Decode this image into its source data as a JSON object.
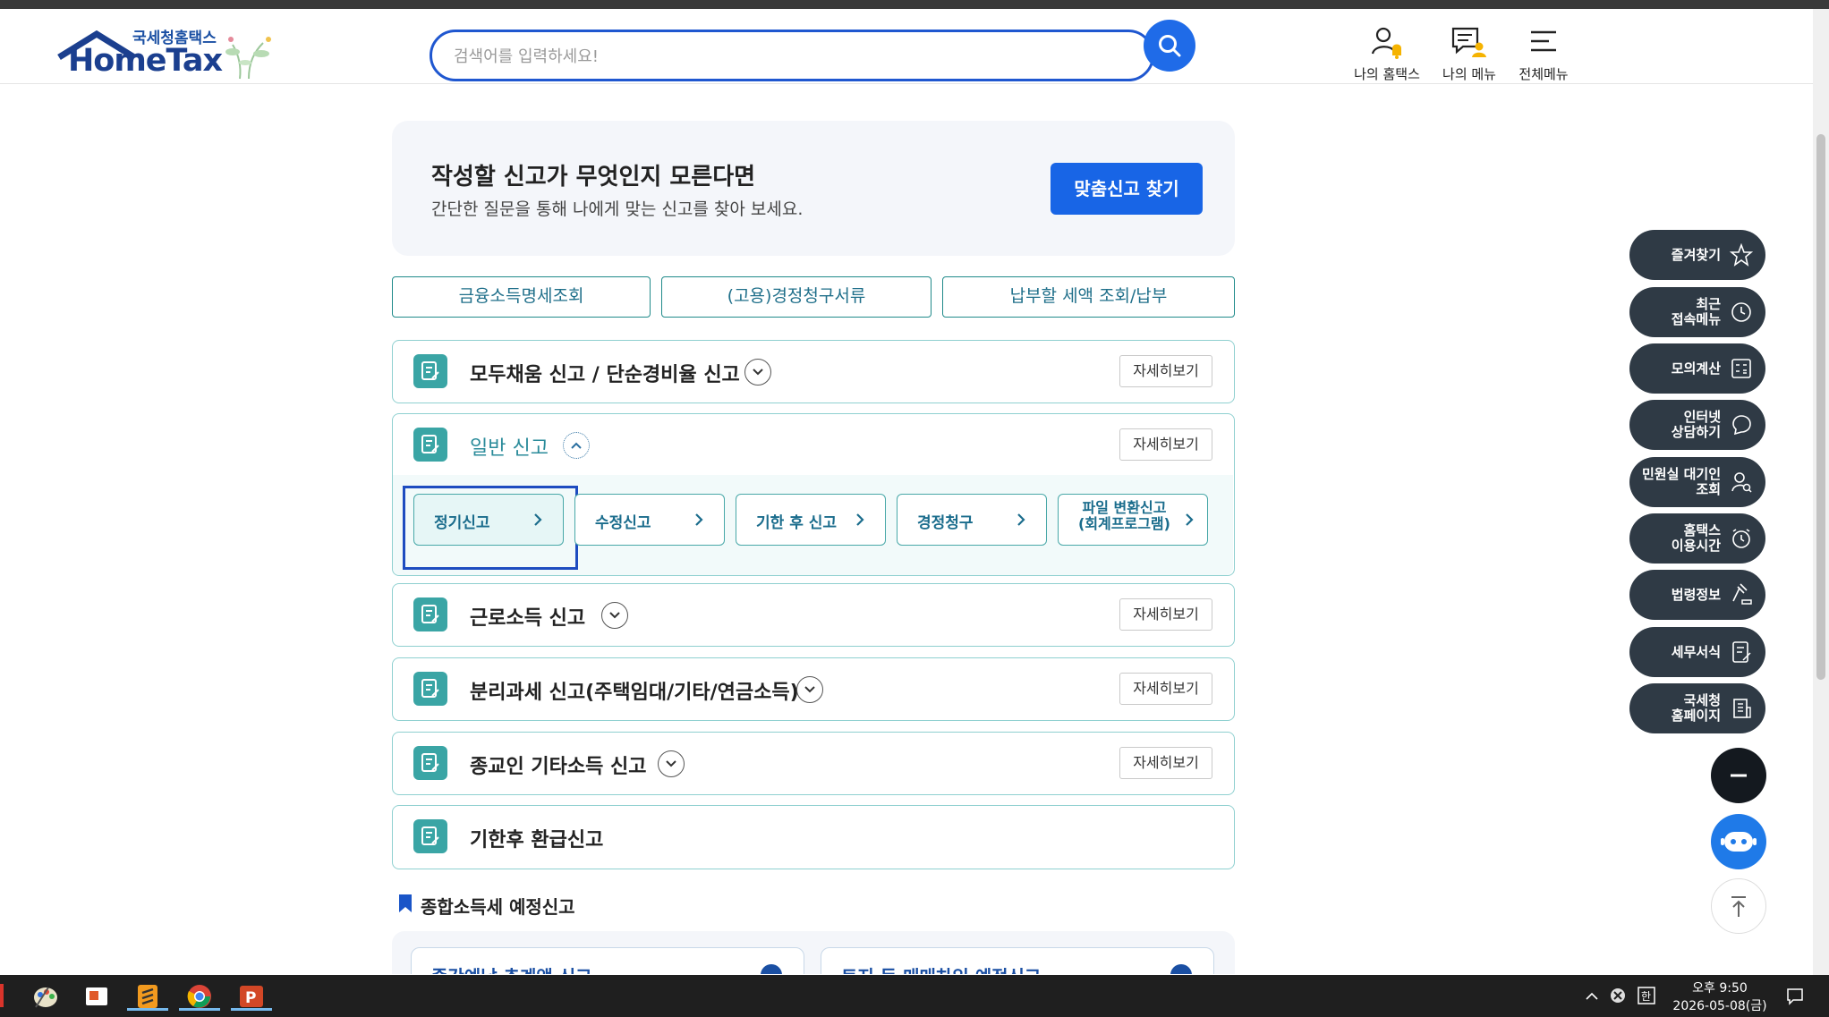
{
  "header": {
    "logo_small": "국세청홈택스",
    "logo_main": "HomeTax",
    "search_placeholder": "검색어를 입력하세요!",
    "nav": [
      "나의 홈택스",
      "나의 메뉴",
      "전체메뉴"
    ]
  },
  "banner": {
    "title": "작성할 신고가 무엇인지 모른다면",
    "subtitle": "간단한 질문을 통해 나에게 맞는 신고를 찾아 보세요.",
    "button": "맞춤신고 찾기"
  },
  "quick_buttons": [
    "금융소득명세조회",
    "(고용)경정청구서류",
    "납부할 세액 조회/납부"
  ],
  "cards": [
    {
      "title": "모두채움 신고 / 단순경비율 신고",
      "detail": "자세히보기"
    },
    {
      "title": "일반 신고",
      "detail": "자세히보기",
      "expanded": true
    },
    {
      "title": "근로소득 신고",
      "detail": "자세히보기"
    },
    {
      "title": "분리과세 신고(주택임대/기타/연금소득)",
      "detail": "자세히보기"
    },
    {
      "title": "종교인 기타소득 신고",
      "detail": "자세히보기"
    },
    {
      "title": "기한후 환급신고"
    }
  ],
  "sub_buttons": [
    "정기신고",
    "수정신고",
    "기한 후 신고",
    "경정청구",
    "파일 변환신고",
    "(회계프로그램)"
  ],
  "section": {
    "title": "종합소득세 예정신고",
    "cards": [
      "중간예납 추계액 신고",
      "토지 등 매매차익 예정신고"
    ]
  },
  "floating_menu": [
    {
      "label": "즐겨찾기",
      "icon": "star-icon"
    },
    {
      "label": "최근\n접속메뉴",
      "icon": "clock-icon"
    },
    {
      "label": "모의계산",
      "icon": "calculator-icon"
    },
    {
      "label": "인터넷\n상담하기",
      "icon": "chat-icon"
    },
    {
      "label": "민원실 대기인\n조회",
      "icon": "person-search-icon"
    },
    {
      "label": "홈택스\n이용시간",
      "icon": "alarm-clock-icon"
    },
    {
      "label": "법령정보",
      "icon": "gavel-icon"
    },
    {
      "label": "세무서식",
      "icon": "document-icon"
    },
    {
      "label": "국세청\n홈페이지",
      "icon": "building-icon"
    }
  ],
  "taskbar": {
    "time": "오후 9:50",
    "date": "2026-05-08(금)"
  },
  "colors": {
    "primary": "#1865e6",
    "teal": "#3aa5a5",
    "dark_pill": "#2f3a45"
  }
}
